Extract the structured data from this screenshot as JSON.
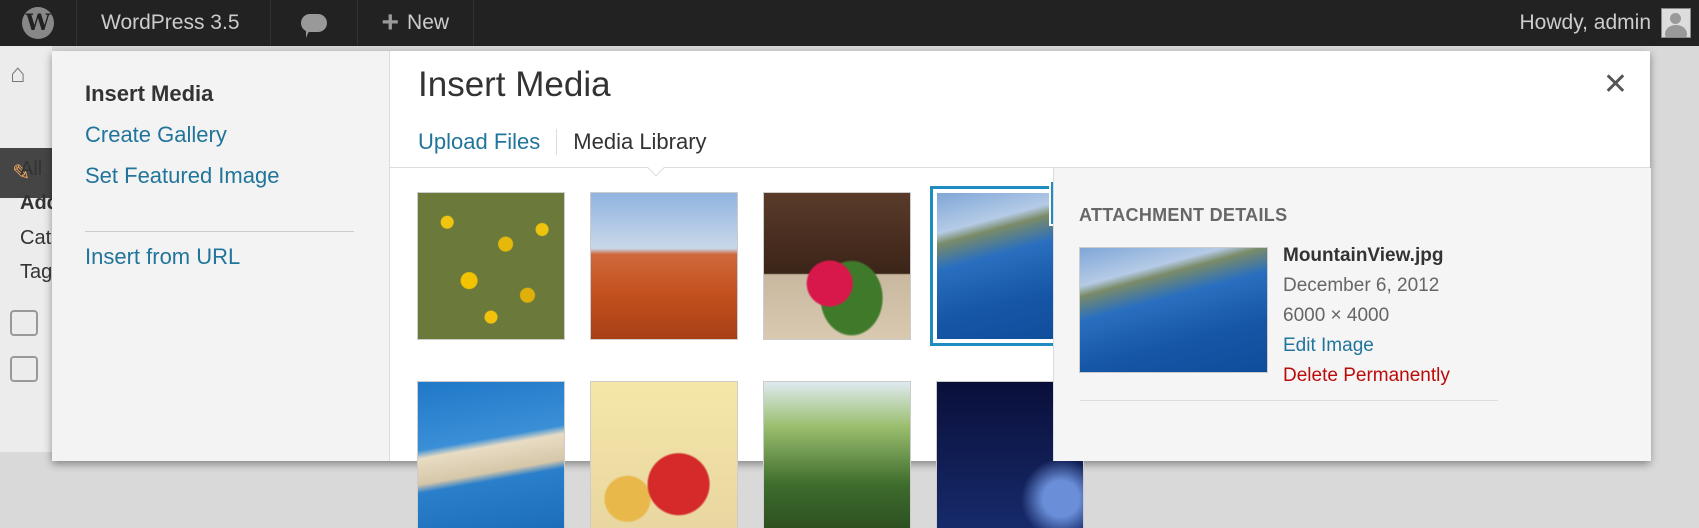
{
  "adminbar": {
    "site_name": "WordPress 3.5",
    "new_label": "New",
    "howdy": "Howdy, admin"
  },
  "admin_menu": {
    "submenu": [
      "All",
      "Add",
      "Cat",
      "Tag"
    ]
  },
  "modal": {
    "menu": {
      "insert_media": "Insert Media",
      "create_gallery": "Create Gallery",
      "set_featured": "Set Featured Image",
      "insert_url": "Insert from URL"
    },
    "title": "Insert Media",
    "close_glyph": "✕",
    "tabs": {
      "upload": "Upload Files",
      "library": "Media Library"
    },
    "check_glyph": "✓",
    "selected_index": 3
  },
  "attachment": {
    "heading": "ATTACHMENT DETAILS",
    "filename": "MountainView.jpg",
    "date": "December 6, 2012",
    "dimensions": "6000 × 4000",
    "edit_label": "Edit Image",
    "delete_label": "Delete Permanently"
  },
  "colors": {
    "link": "#21759b",
    "select_blue": "#1e8cbe",
    "delete_red": "#bc0b0b",
    "adminbar": "#222222"
  }
}
